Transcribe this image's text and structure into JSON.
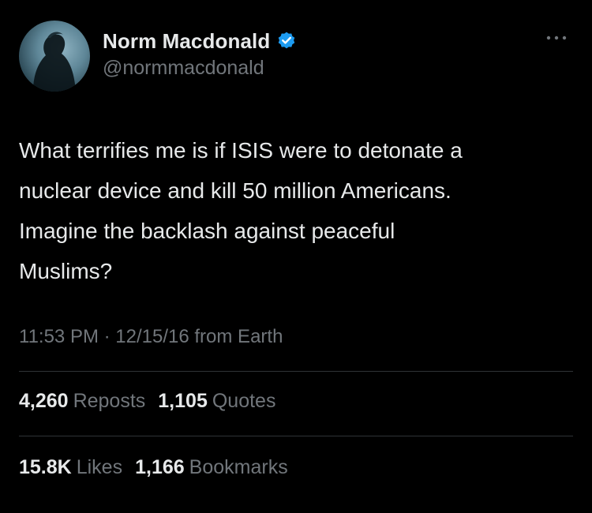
{
  "author": {
    "display_name": "Norm Macdonald",
    "handle": "@normmacdonald",
    "verified": true,
    "avatar_icon": "avatar-photo"
  },
  "tweet": {
    "text": "What terrifies me is if ISIS were to detonate a\nnuclear device and kill 50 million Americans.\nImagine the backlash against peaceful\nMuslims?",
    "time": "11:53 PM",
    "separator": "·",
    "date": "12/15/16",
    "source": "from Earth"
  },
  "stats": {
    "reposts_count": "4,260",
    "reposts_label": "Reposts",
    "quotes_count": "1,105",
    "quotes_label": "Quotes",
    "likes_count": "15.8K",
    "likes_label": "Likes",
    "bookmarks_count": "1,166",
    "bookmarks_label": "Bookmarks"
  },
  "colors": {
    "background": "#000000",
    "primary_text": "#e7e9ea",
    "secondary_text": "#71767b",
    "divider": "#2f3336",
    "verified_badge": "#1d9bf0"
  }
}
